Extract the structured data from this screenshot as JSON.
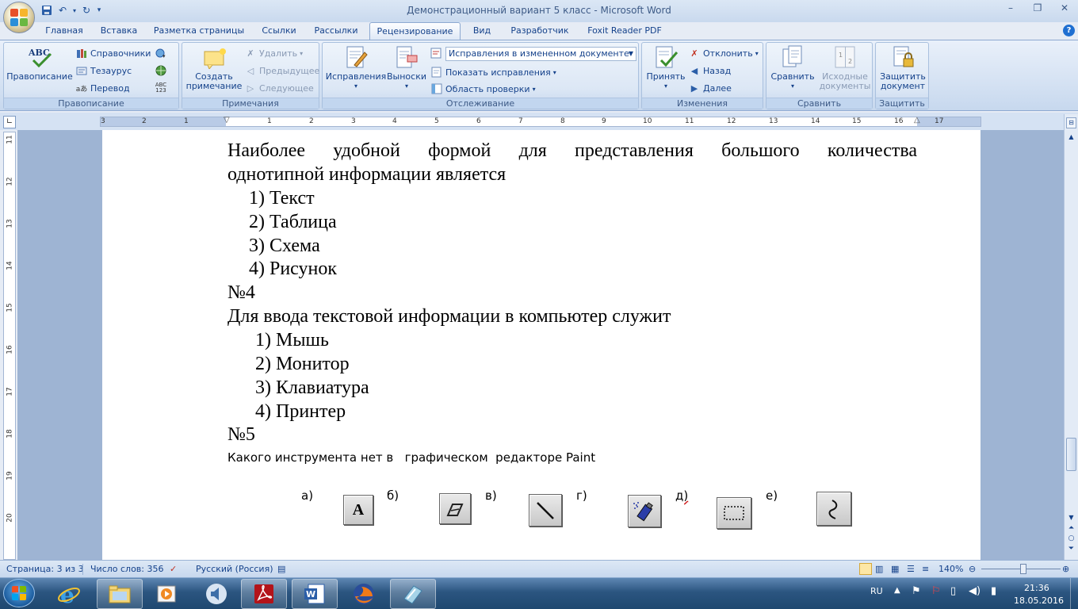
{
  "window": {
    "title": "Демонстрационный вариант 5 класс - Microsoft Word"
  },
  "tabs": [
    "Главная",
    "Вставка",
    "Разметка страницы",
    "Ссылки",
    "Рассылки",
    "Рецензирование",
    "Вид",
    "Разработчик",
    "Foxit Reader PDF"
  ],
  "active_tab": "Рецензирование",
  "ribbon": {
    "spelling": {
      "label": "Правописание",
      "abc": "ABC",
      "spell_btn": "Правописание",
      "references": "Справочники",
      "thesaurus": "Тезаурус",
      "translate": "Перевод"
    },
    "comments": {
      "label": "Примечания",
      "create_1": "Создать",
      "create_2": "примечание",
      "delete": "Удалить",
      "prev": "Предыдущее",
      "next": "Следующее"
    },
    "tracking": {
      "label": "Отслеживание",
      "track_btn": "Исправления",
      "balloons": "Выноски",
      "display": "Исправления в измененном документе",
      "show_markup": "Показать исправления",
      "review_pane": "Область проверки"
    },
    "changes": {
      "label": "Изменения",
      "accept": "Принять",
      "reject": "Отклонить",
      "prev": "Назад",
      "next": "Далее"
    },
    "compare": {
      "label": "Сравнить",
      "compare_btn": "Сравнить",
      "source_1": "Исходные",
      "source_2": "документы"
    },
    "protect": {
      "label": "Защитить",
      "protect_1": "Защитить",
      "protect_2": "документ"
    }
  },
  "document": {
    "q3_text_1": "Наиболее   удобной   формой   для   представления   большого   количества",
    "q3_text_2": "однотипной информации является",
    "q3_options": [
      "1)  Текст",
      "2)  Таблица",
      "3)  Схема",
      "4)  Рисунок"
    ],
    "q4_num": "№4",
    "q4_text": "Для ввода текстовой информации в компьютер служит",
    "q4_options": [
      "1)  Мышь",
      "2)  Монитор",
      "3)  Клавиатура",
      "4)  Принтер"
    ],
    "q5_num": "№5",
    "q5_text": "Какого инструмента нет в   графическом  редакторе Paint",
    "q5_labels": [
      "а)",
      "б)",
      "в)",
      "г)",
      "д)",
      "е)"
    ],
    "tool_icons": [
      "text-tool-icon",
      "eraser-tool-icon",
      "line-tool-icon",
      "spray-tool-icon",
      "select-tool-icon",
      "curve-tool-icon"
    ]
  },
  "status": {
    "page": "Страница: 3 из 3",
    "words": "Число слов: 356",
    "language": "Русский (Россия)",
    "zoom": "140%"
  },
  "taskbar": {
    "lang": "RU",
    "time": "21:36",
    "date": "18.05.2016"
  },
  "ruler": {
    "h_numbers": [
      "3",
      "2",
      "1",
      "1",
      "2",
      "3",
      "4",
      "5",
      "6",
      "7",
      "8",
      "9",
      "10",
      "11",
      "12",
      "13",
      "14",
      "15",
      "16",
      "17"
    ],
    "v_numbers": [
      "11",
      "12",
      "13",
      "14",
      "15",
      "16",
      "17",
      "18",
      "19",
      "20"
    ]
  }
}
